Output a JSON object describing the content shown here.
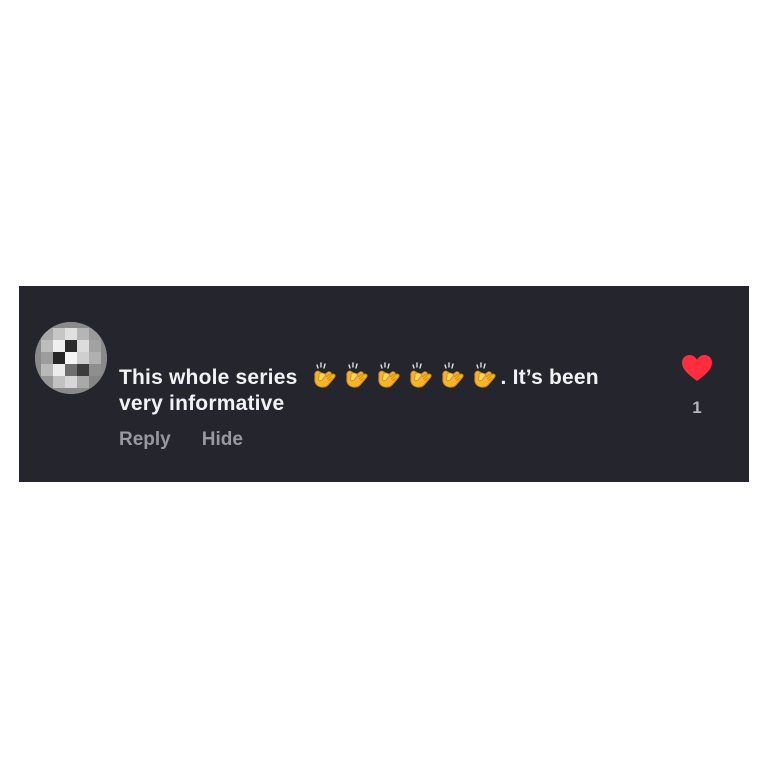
{
  "comment": {
    "text_before": "This whole series",
    "emoji": "clapping-hands-icon",
    "emoji_count": 6,
    "text_after": ". It’s been very informative",
    "actions": {
      "reply_label": "Reply",
      "hide_label": "Hide"
    },
    "likes": {
      "count": "1",
      "icon": "heart-icon",
      "color": "#ff2d3d"
    }
  },
  "theme": {
    "card_background": "#25262d",
    "text_color": "#f2f2f4",
    "muted_color": "#9799a2"
  }
}
